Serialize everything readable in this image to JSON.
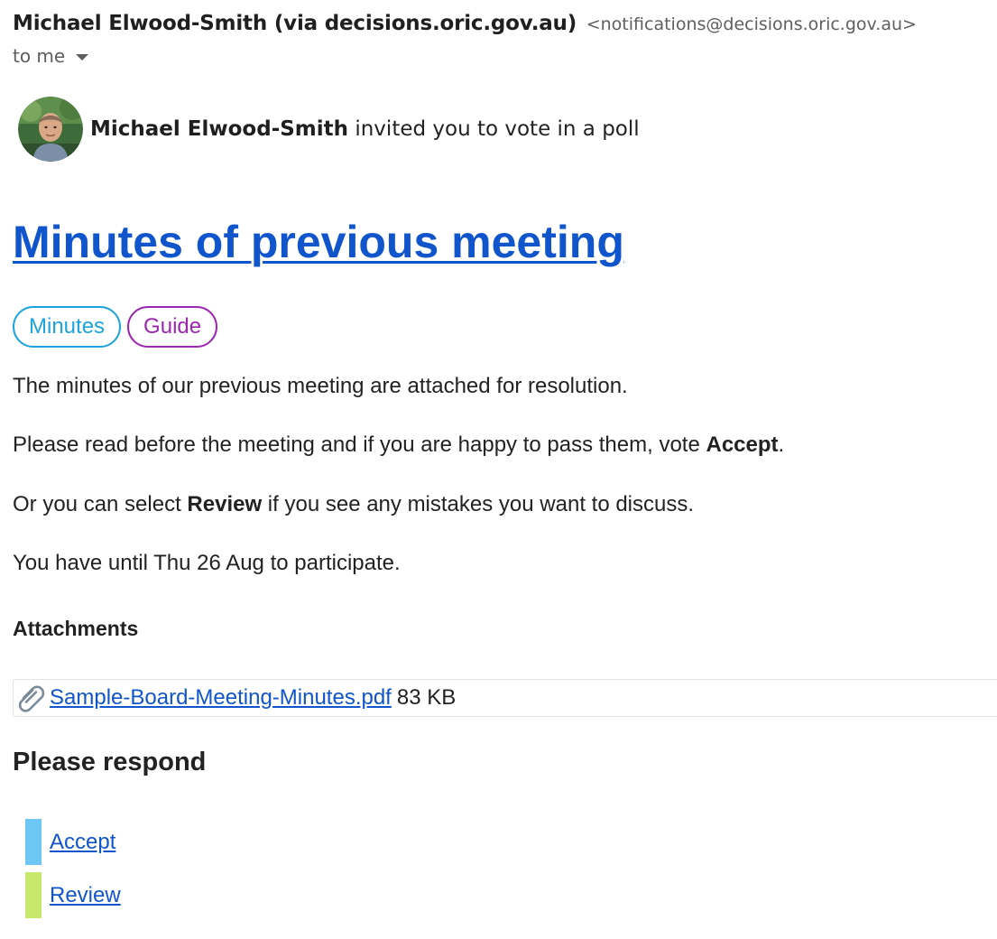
{
  "email_header": {
    "sender_name": "Michael Elwood-Smith (via decisions.oric.gov.au)",
    "sender_email": "<notifications@decisions.oric.gov.au>",
    "recipient": "to me"
  },
  "invite": {
    "inviter_name": "Michael Elwood-Smith",
    "invite_text": "invited you to vote in a poll"
  },
  "poll": {
    "title": "Minutes of previous meeting",
    "tags": [
      {
        "label": "Minutes",
        "color": "#1ea3de"
      },
      {
        "label": "Guide",
        "color": "#9c27b0"
      }
    ],
    "description": {
      "line1": "The minutes of our previous meeting are attached for resolution.",
      "line2_pre": "Please read before the meeting and if you are happy to pass them, vote ",
      "line2_bold": "Accept",
      "line2_post": ".",
      "line3_pre": "Or you can select ",
      "line3_bold": "Review",
      "line3_post": " if you see any mistakes you want to discuss.",
      "deadline": "You have until Thu 26 Aug to participate."
    }
  },
  "attachments": {
    "heading": "Attachments",
    "items": [
      {
        "filename": "Sample-Board-Meeting-Minutes.pdf ",
        "size": "83 KB",
        "icon": "paperclip-icon"
      }
    ]
  },
  "respond": {
    "heading": "Please respond",
    "options": [
      {
        "label": "Accept",
        "color": "#6ec6f5"
      },
      {
        "label": "Review",
        "color": "#c6e86b"
      }
    ]
  },
  "colors": {
    "link": "#1155cc",
    "text": "#222222",
    "muted": "#5e5e5e"
  }
}
